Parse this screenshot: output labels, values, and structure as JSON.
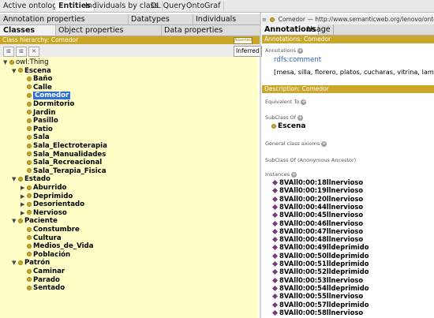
{
  "top_tabs": [
    "Active ontology",
    "Entities",
    "Individuals by class",
    "DL Query",
    "OntoGraf"
  ],
  "left_tabs_row1": [
    "Annotation properties",
    "Datatypes",
    "Individuals"
  ],
  "left_tabs_row2": [
    "Classes",
    "Object properties",
    "Data properties"
  ],
  "class_hierarchy_title": "Class hierarchy: Comedor",
  "class_hierarchy_badge": "Asserted",
  "inferred_select": "Inferred",
  "tree": [
    {
      "label": "owl:Thing",
      "level": 0,
      "twisty": "▼",
      "root": true
    },
    {
      "label": "Escena",
      "level": 1,
      "twisty": "▼"
    },
    {
      "label": "Baño",
      "level": 2,
      "twisty": ""
    },
    {
      "label": "Calle",
      "level": 2,
      "twisty": ""
    },
    {
      "label": "Comedor",
      "level": 2,
      "twisty": "",
      "selected": true
    },
    {
      "label": "Dormitorio",
      "level": 2,
      "twisty": ""
    },
    {
      "label": "Jardin",
      "level": 2,
      "twisty": ""
    },
    {
      "label": "Pasillo",
      "level": 2,
      "twisty": ""
    },
    {
      "label": "Patio",
      "level": 2,
      "twisty": ""
    },
    {
      "label": "Sala",
      "level": 2,
      "twisty": ""
    },
    {
      "label": "Sala_Electroterapia",
      "level": 2,
      "twisty": ""
    },
    {
      "label": "Sala_Manualidades",
      "level": 2,
      "twisty": ""
    },
    {
      "label": "Sala_Recreacional",
      "level": 2,
      "twisty": ""
    },
    {
      "label": "Sala_Terapia_Fisica",
      "level": 2,
      "twisty": ""
    },
    {
      "label": "Estado",
      "level": 1,
      "twisty": "▼"
    },
    {
      "label": "Aburrido",
      "level": 2,
      "twisty": "▶"
    },
    {
      "label": "Deprimido",
      "level": 2,
      "twisty": "▶"
    },
    {
      "label": "Desorientado",
      "level": 2,
      "twisty": "▶"
    },
    {
      "label": "Nervioso",
      "level": 2,
      "twisty": "▶"
    },
    {
      "label": "Paciente",
      "level": 1,
      "twisty": "▼"
    },
    {
      "label": "Constumbre",
      "level": 2,
      "twisty": ""
    },
    {
      "label": "Cultura",
      "level": 2,
      "twisty": ""
    },
    {
      "label": "Medios_de_Vida",
      "level": 2,
      "twisty": ""
    },
    {
      "label": "Población",
      "level": 2,
      "twisty": ""
    },
    {
      "label": "Patrón",
      "level": 1,
      "twisty": "▼"
    },
    {
      "label": "Caminar",
      "level": 2,
      "twisty": ""
    },
    {
      "label": "Parado",
      "level": 2,
      "twisty": ""
    },
    {
      "label": "Sentado",
      "level": 2,
      "twisty": ""
    }
  ],
  "right": {
    "entity_header": "Comedor — http://www.semanticweb.org/lenovo/ontologies/2021/6/untitl",
    "tabs": [
      "Annotations",
      "Usage"
    ],
    "annotations_bar": "Annotations: Comedor",
    "annotations_label": "Annotations",
    "annotation_property": "rdfs:comment",
    "annotation_value": "[mesa, silla, florero, platos, cucharas, vitrina, lampara]",
    "description_bar": "Description: Comedor",
    "equivalent_to": "Equivalent To",
    "subclass_of": "SubClass Of",
    "subclass_value": "Escena",
    "general_axioms": "General class axioms",
    "anonymous_ancestor": "SubClass Of (Anonymous Ancestor)",
    "instances_label": "Instances",
    "instances": [
      "8VAll0:00:18llnervioso",
      "8VAll0:00:19llnervioso",
      "8VAll0:00:20llnervioso",
      "8VAll0:00:44llnervioso",
      "8VAll0:00:45llnervioso",
      "8VAll0:00:46llnervioso",
      "8VAll0:00:47llnervioso",
      "8VAll0:00:48llnervioso",
      "8VAll0:00:49lldeprimido",
      "8VAll0:00:50lldeprimido",
      "8VAll0:00:51lldeprimido",
      "8VAll0:00:52lldeprimido",
      "8VAll0:00:53llnervioso",
      "8VAll0:00:54lldeprimido",
      "8VAll0:00:55llnervioso",
      "8VAll0:00:57lldeprimido",
      "8VAll0:00:58llnervioso"
    ]
  }
}
